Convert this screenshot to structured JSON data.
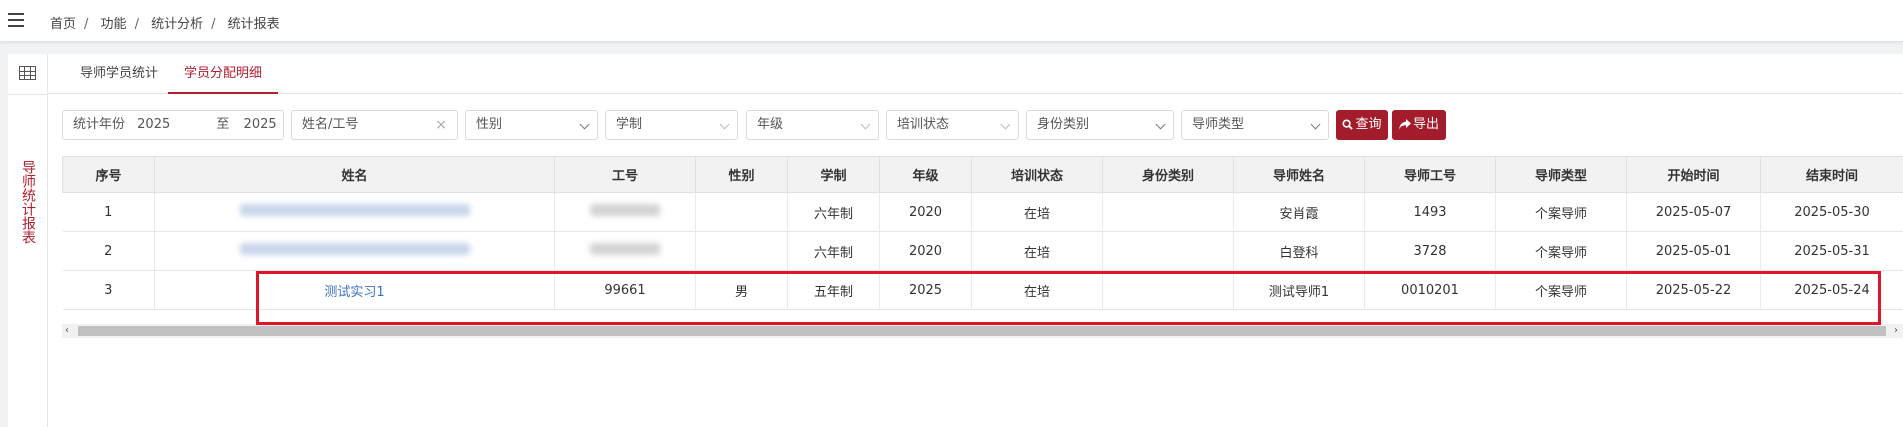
{
  "breadcrumb": [
    "首页",
    "功能",
    "统计分析",
    "统计报表"
  ],
  "sidebar": {
    "vertical_label": "导师统计报表"
  },
  "tabs": [
    {
      "label": "导师学员统计",
      "active": false
    },
    {
      "label": "学员分配明细",
      "active": true
    }
  ],
  "filters": {
    "year_label": "统计年份",
    "year_from": "2025",
    "year_to_label": "至",
    "year_to": "2025",
    "name_placeholder": "姓名/工号",
    "gender": "性别",
    "school_system": "学制",
    "grade": "年级",
    "training_status": "培训状态",
    "identity_type": "身份类别",
    "mentor_type": "导师类型"
  },
  "buttons": {
    "query": "查询",
    "export": "导出"
  },
  "table": {
    "headers": [
      "序号",
      "姓名",
      "工号",
      "性别",
      "学制",
      "年级",
      "培训状态",
      "身份类别",
      "导师姓名",
      "导师工号",
      "导师类型",
      "开始时间",
      "结束时间"
    ],
    "rows": [
      {
        "index": "1",
        "name": "",
        "id": "",
        "gender": "",
        "system": "六年制",
        "grade": "2020",
        "status": "在培",
        "identity": "",
        "mentor": "安肖霞",
        "mentor_id": "1493",
        "mentor_type": "个案导师",
        "start": "2025-05-07",
        "end": "2025-05-30"
      },
      {
        "index": "2",
        "name": "",
        "id": "",
        "gender": "",
        "system": "六年制",
        "grade": "2020",
        "status": "在培",
        "identity": "",
        "mentor": "白登科",
        "mentor_id": "3728",
        "mentor_type": "个案导师",
        "start": "2025-05-01",
        "end": "2025-05-31"
      },
      {
        "index": "3",
        "name": "测试实习1",
        "id": "99661",
        "gender": "男",
        "system": "五年制",
        "grade": "2025",
        "status": "在培",
        "identity": "",
        "mentor": "测试导师1",
        "mentor_id": "0010201",
        "mentor_type": "个案导师",
        "start": "2025-05-22",
        "end": "2025-05-24"
      }
    ]
  },
  "colors": {
    "accent": "#a21c2b",
    "highlight": "#e0152a",
    "link": "#3d6fc3"
  }
}
